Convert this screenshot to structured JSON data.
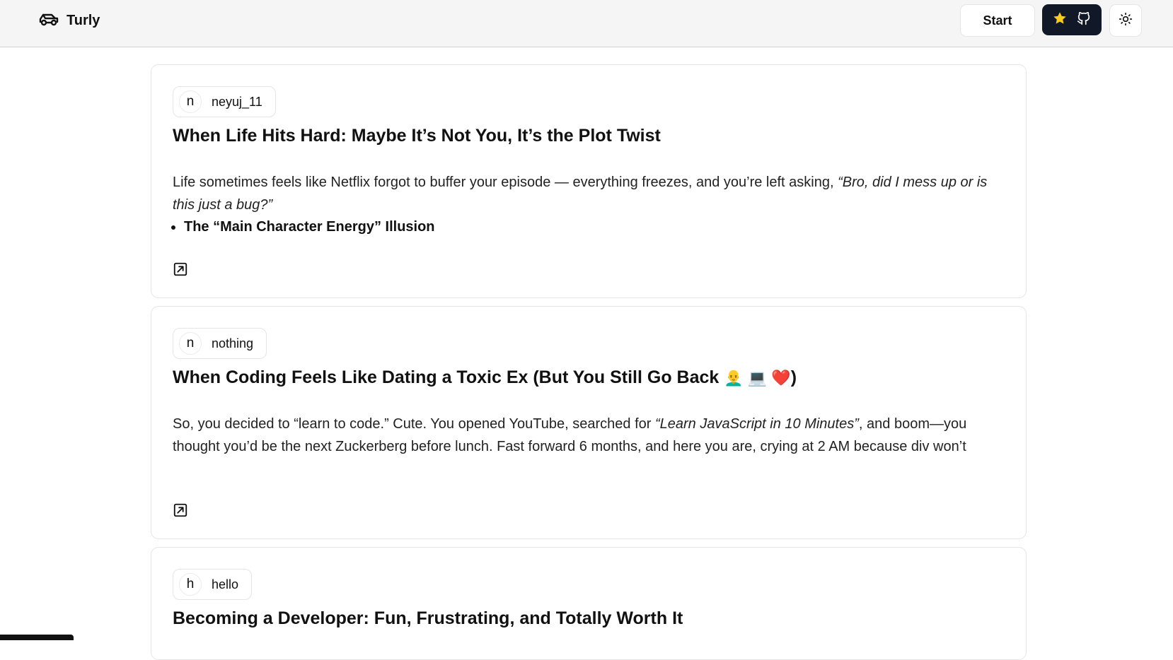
{
  "header": {
    "brand": "Turly",
    "start_label": "Start",
    "star_icon": "star-icon",
    "github_icon": "github-icon",
    "theme_icon": "sun-icon",
    "accent_color": "#111827",
    "star_color": "#facc15"
  },
  "posts": [
    {
      "avatar_letter": "n",
      "username": "neyuj_11",
      "title": "When Life Hits Hard: Maybe It’s Not You, It’s the Plot Twist",
      "excerpt_plain": "Life sometimes feels like Netflix forgot to buffer your episode — everything freezes, and you’re left asking, ",
      "excerpt_italic": "“Bro, did I mess up or is this just a bug?”",
      "bullet": "The “Main Character Energy” Illusion"
    },
    {
      "avatar_letter": "n",
      "username": "nothing",
      "title": "When Coding Feels Like Dating a Toxic Ex (But You Still Go Back ",
      "title_emojis": "👨‍🦲 💻 ❤️",
      "title_suffix": ")",
      "excerpt_plain": "So, you decided to “learn to code.” Cute. You opened YouTube, searched for ",
      "excerpt_italic": "“Learn JavaScript in 10 Minutes”",
      "excerpt_rest": ", and boom—you thought you’d be the next Zuckerberg before lunch. Fast forward 6 months, and here you are, crying at 2 AM because div won’t"
    },
    {
      "avatar_letter": "h",
      "username": "hello",
      "title": "Becoming a Developer: Fun, Frustrating, and Totally Worth It"
    }
  ]
}
